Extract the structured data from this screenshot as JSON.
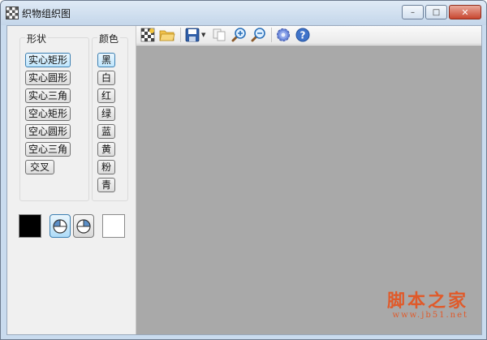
{
  "window": {
    "title": "织物组织图",
    "controls": {
      "minimize": "–",
      "maximize": "□",
      "close": "✕"
    }
  },
  "shape_group": {
    "title": "形状",
    "buttons": [
      "实心矩形",
      "实心圆形",
      "实心三角",
      "空心矩形",
      "空心圆形",
      "空心三角",
      "交叉"
    ],
    "active_index": 0
  },
  "color_group": {
    "title": "颜色",
    "buttons": [
      "黑",
      "白",
      "红",
      "绿",
      "蓝",
      "黄",
      "粉",
      "青"
    ],
    "active_index": 0
  },
  "swatches": {
    "foreground_color": "#000000",
    "background_color": "#ffffff"
  },
  "toolbar": {
    "icons": [
      "new-pattern-icon",
      "open-folder-icon",
      "save-icon",
      "save-dropdown-icon",
      "copy-icon",
      "zoom-in-icon",
      "zoom-out-icon",
      "settings-icon",
      "help-icon"
    ]
  },
  "canvas": {
    "background": "#a9a9a9"
  },
  "watermark": {
    "main": "脚本之家",
    "sub": "www.jb51.net"
  }
}
